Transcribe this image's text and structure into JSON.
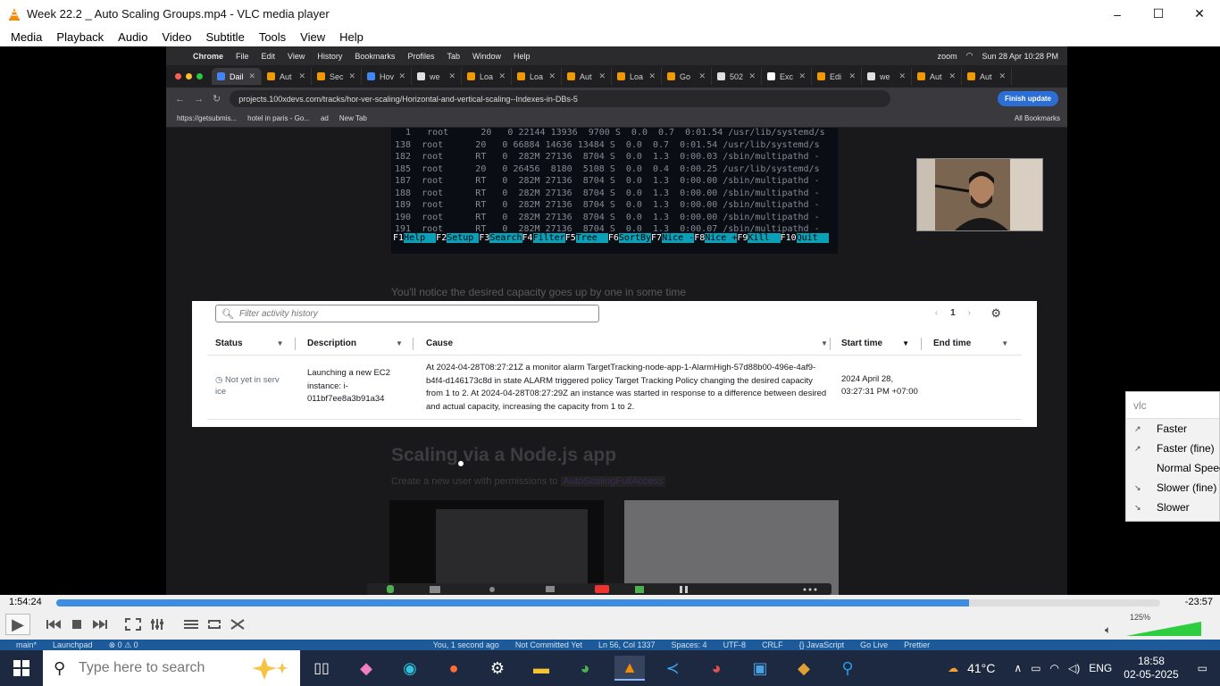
{
  "window": {
    "title": "Week 22.2 _ Auto Scaling Groups.mp4 - VLC media player",
    "controls": [
      "–",
      "☐",
      "✕"
    ]
  },
  "menu": [
    "Media",
    "Playback",
    "Audio",
    "Video",
    "Subtitle",
    "Tools",
    "View",
    "Help"
  ],
  "mac_bar": {
    "left": [
      "Chrome",
      "File",
      "Edit",
      "View",
      "History",
      "Bookmarks",
      "Profiles",
      "Tab",
      "Window",
      "Help"
    ],
    "zoom": "zoom",
    "datetime": "Sun 28 Apr 10:28 PM"
  },
  "chrome": {
    "tabs": [
      {
        "label": "Dail",
        "color": "#4285f4",
        "active": true
      },
      {
        "label": "Aut",
        "color": "#f29900"
      },
      {
        "label": "Sec",
        "color": "#f29900"
      },
      {
        "label": "Hov",
        "color": "#4285f4"
      },
      {
        "label": "we",
        "color": "#e0e0e0"
      },
      {
        "label": "Loa",
        "color": "#f29900"
      },
      {
        "label": "Loa",
        "color": "#f29900"
      },
      {
        "label": "Aut",
        "color": "#f29900"
      },
      {
        "label": "Loa",
        "color": "#f29900"
      },
      {
        "label": "Go",
        "color": "#f29900"
      },
      {
        "label": "502",
        "color": "#e0e0e0"
      },
      {
        "label": "Exc",
        "color": "#ffffff"
      },
      {
        "label": "Edi",
        "color": "#f29900"
      },
      {
        "label": "we",
        "color": "#e0e0e0"
      },
      {
        "label": "Aut",
        "color": "#f29900"
      },
      {
        "label": "Aut",
        "color": "#f29900"
      }
    ],
    "url": "projects.100xdevs.com/tracks/hor-ver-scaling/Horizontal-and-vertical-scaling--Indexes-in-DBs-5",
    "finish_update": "Finish update",
    "bookmarks": [
      "https://getsubmis...",
      "hotel in paris - Go...",
      "ad",
      "New Tab"
    ],
    "all_bookmarks": "All Bookmarks"
  },
  "terminal": {
    "lines": [
      "  1   root      20   0 22144 13936  9700 S  0.0  0.7  0:01.54 /usr/lib/systemd/s",
      "138  root      20   0 66884 14636 13484 S  0.0  0.7  0:01.54 /usr/lib/systemd/s",
      "182  root      RT   0  282M 27136  8704 S  0.0  1.3  0:00.03 /sbin/multipathd -",
      "185  root      20   0 26456  8180  5108 S  0.0  0.4  0:00.25 /usr/lib/systemd/s",
      "187  root      RT   0  282M 27136  8704 S  0.0  1.3  0:00.00 /sbin/multipathd -",
      "188  root      RT   0  282M 27136  8704 S  0.0  1.3  0:00.00 /sbin/multipathd -",
      "189  root      RT   0  282M 27136  8704 S  0.0  1.3  0:00.00 /sbin/multipathd -",
      "190  root      RT   0  282M 27136  8704 S  0.0  1.3  0:00.00 /sbin/multipathd -",
      "191  root      RT   0  282M 27136  8704 S  0.0  1.3  0:00.07 /sbin/multipathd -"
    ],
    "keys": [
      {
        "k": "F1",
        "v": "Help  "
      },
      {
        "k": "F2",
        "v": "Setup "
      },
      {
        "k": "F3",
        "v": "Search"
      },
      {
        "k": "F4",
        "v": "Filter"
      },
      {
        "k": "F5",
        "v": "Tree  "
      },
      {
        "k": "F6",
        "v": "SortBy"
      },
      {
        "k": "F7",
        "v": "Nice -"
      },
      {
        "k": "F8",
        "v": "Nice +"
      },
      {
        "k": "F9",
        "v": "Kill  "
      },
      {
        "k": "F10",
        "v": "Quit  "
      }
    ]
  },
  "page": {
    "notice": "You'll notice the desired capacity goes up by one in some time",
    "heading": "Scaling via a Node.js app",
    "para_prefix": "Create a new user with permissions to",
    "para_code": "AutoScalingFullAccess"
  },
  "aws": {
    "search_placeholder": "Filter activity history",
    "page": "1",
    "columns": [
      "Status",
      "Description",
      "Cause",
      "Start time",
      "End time"
    ],
    "row": {
      "status": "Not yet in serv ice",
      "description": "Launching a new EC2 instance: i-011bf7ee8a3b91a34",
      "cause": "At 2024-04-28T08:27:21Z a monitor alarm TargetTracking-node-app-1-AlarmHigh-57d88b00-496e-4af9-b4f4-d146173c8d in state ALARM triggered policy Target Tracking Policy changing the desired capacity from 1 to 2. At 2024-04-28T08:27:29Z an instance was started in response to a difference between desired and actual capacity, increasing the capacity from 1 to 2.",
      "start_time": "2024 April 28, 03:27:31 PM +07:00",
      "end_time": ""
    }
  },
  "speed_menu": {
    "search": "vlc",
    "items": [
      {
        "label": "Faster",
        "icon": "↗"
      },
      {
        "label": "Faster (fine)",
        "icon": "↗"
      },
      {
        "label": "Normal Speed",
        "icon": ""
      },
      {
        "label": "Slower (fine)",
        "icon": "↘"
      },
      {
        "label": "Slower",
        "icon": "↘"
      }
    ]
  },
  "player": {
    "elapsed": "1:54:24",
    "remaining": "-23:57",
    "progress": 0.827,
    "volume_pct": "125%",
    "volume": 1.25
  },
  "vscode_status": [
    "main*",
    "Launchpad",
    "⊗ 0 ⚠ 0",
    "You, 1 second ago",
    "Not Committed Yet",
    "Ln 56, Col 1337",
    "Spaces: 4",
    "UTF-8",
    "CRLF",
    "{} JavaScript",
    "Go Live",
    "Prettier"
  ],
  "taskbar": {
    "search_placeholder": "Type here to search",
    "weather": "41°C",
    "lang": "ENG",
    "time": "18:58",
    "date": "02-05-2025"
  },
  "colors": {
    "vlc_orange": "#f28c00",
    "progress_blue": "#3d8ee3",
    "taskbar": "#1d2940",
    "chrome_finish": "#2b6fd6"
  }
}
